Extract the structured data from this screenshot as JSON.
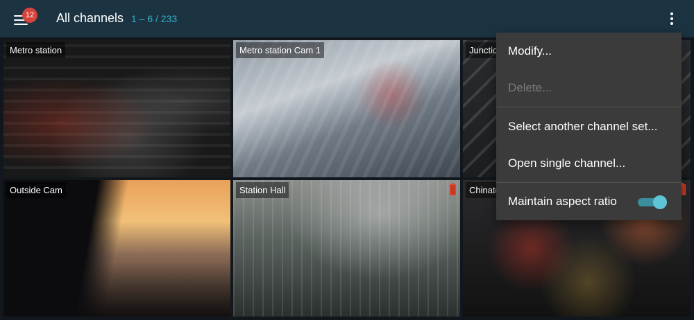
{
  "header": {
    "notification_count": "12",
    "title": "All channels",
    "range": "1 – 6 / 233"
  },
  "tiles": [
    {
      "label": "Metro station"
    },
    {
      "label": "Metro station Cam 1"
    },
    {
      "label": "Junction"
    },
    {
      "label": "Outside Cam"
    },
    {
      "label": "Station Hall"
    },
    {
      "label": "Chinatown"
    }
  ],
  "menu": {
    "modify": "Modify...",
    "delete": "Delete...",
    "select_set": "Select another channel set...",
    "open_single": "Open single channel...",
    "aspect_ratio": "Maintain aspect ratio",
    "aspect_ratio_on": true
  },
  "colors": {
    "header_bg": "#1c3342",
    "accent": "#2eb3c9",
    "badge": "#d5443a",
    "menu_bg": "#3b3b3b",
    "toggle_on": "#5ec4d6",
    "battery_alert": "#e2482f"
  },
  "icons": {
    "menu": "hamburger-icon",
    "more": "more-vert-icon",
    "battery": "battery-alert-icon"
  }
}
